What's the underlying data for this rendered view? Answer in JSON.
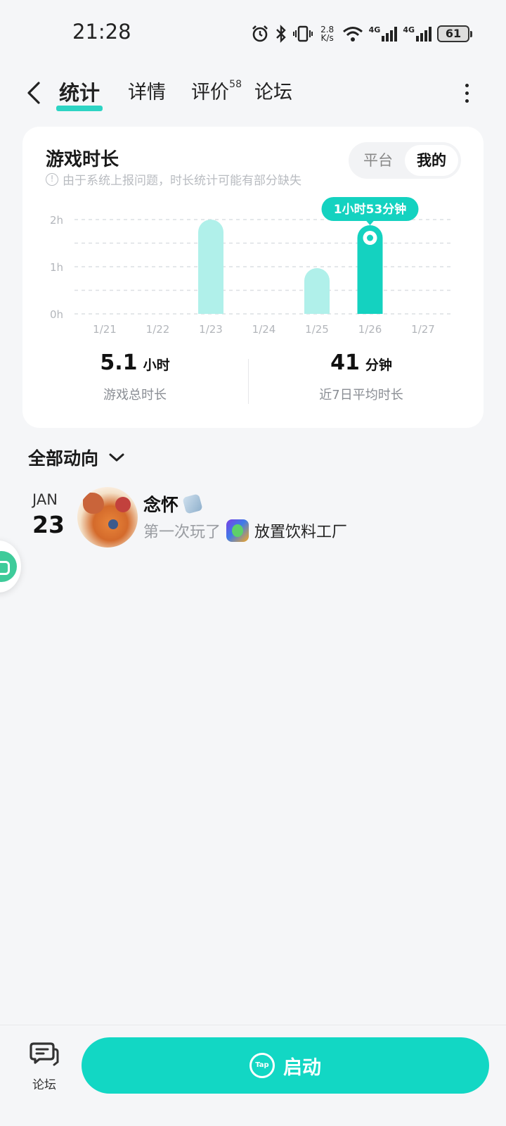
{
  "status_bar": {
    "time": "21:28",
    "net_speed_value": "2.8",
    "net_speed_unit": "K/s",
    "signal_1_label": "4G",
    "signal_2_label": "4G",
    "battery": "61",
    "icons": [
      "alarm-icon",
      "bluetooth-icon",
      "vibrate-icon",
      "wifi-icon"
    ]
  },
  "nav": {
    "tabs": [
      {
        "label": "统计",
        "active": true
      },
      {
        "label": "详情",
        "active": false
      },
      {
        "label": "评价",
        "active": false,
        "badge": "58"
      },
      {
        "label": "论坛",
        "active": false
      }
    ]
  },
  "stats": {
    "title": "游戏时长",
    "note": "由于系统上报问题，时长统计可能有部分缺失",
    "toggle": {
      "options": [
        "平台",
        "我的"
      ],
      "selected": "我的"
    },
    "total": {
      "value": "5.1",
      "unit": "小时",
      "label": "游戏总时长"
    },
    "average": {
      "value": "41",
      "unit": "分钟",
      "label": "近7日平均时长"
    }
  },
  "chart_data": {
    "type": "bar",
    "categories": [
      "1/21",
      "1/22",
      "1/23",
      "1/24",
      "1/25",
      "1/26",
      "1/27"
    ],
    "values": [
      0,
      0,
      2.0,
      0,
      0.97,
      1.88
    ],
    "y_ticks": [
      "0h",
      "1h",
      "2h"
    ],
    "ylim": [
      0,
      2
    ],
    "highlight_index": 5,
    "highlight_label": "1小时53分钟",
    "colors": {
      "bar": "#b0f0ea",
      "highlight": "#14d2c0",
      "grid": "#dcdfe3"
    }
  },
  "activity": {
    "section_title": "全部动向",
    "items": [
      {
        "month": "JAN",
        "day": "23",
        "user": "念怀",
        "verb": "第一次玩了",
        "game": "放置饮料工厂"
      }
    ]
  },
  "bottom_bar": {
    "forum_label": "论坛",
    "launch_label": "启动",
    "launch_logo": "Tap"
  }
}
